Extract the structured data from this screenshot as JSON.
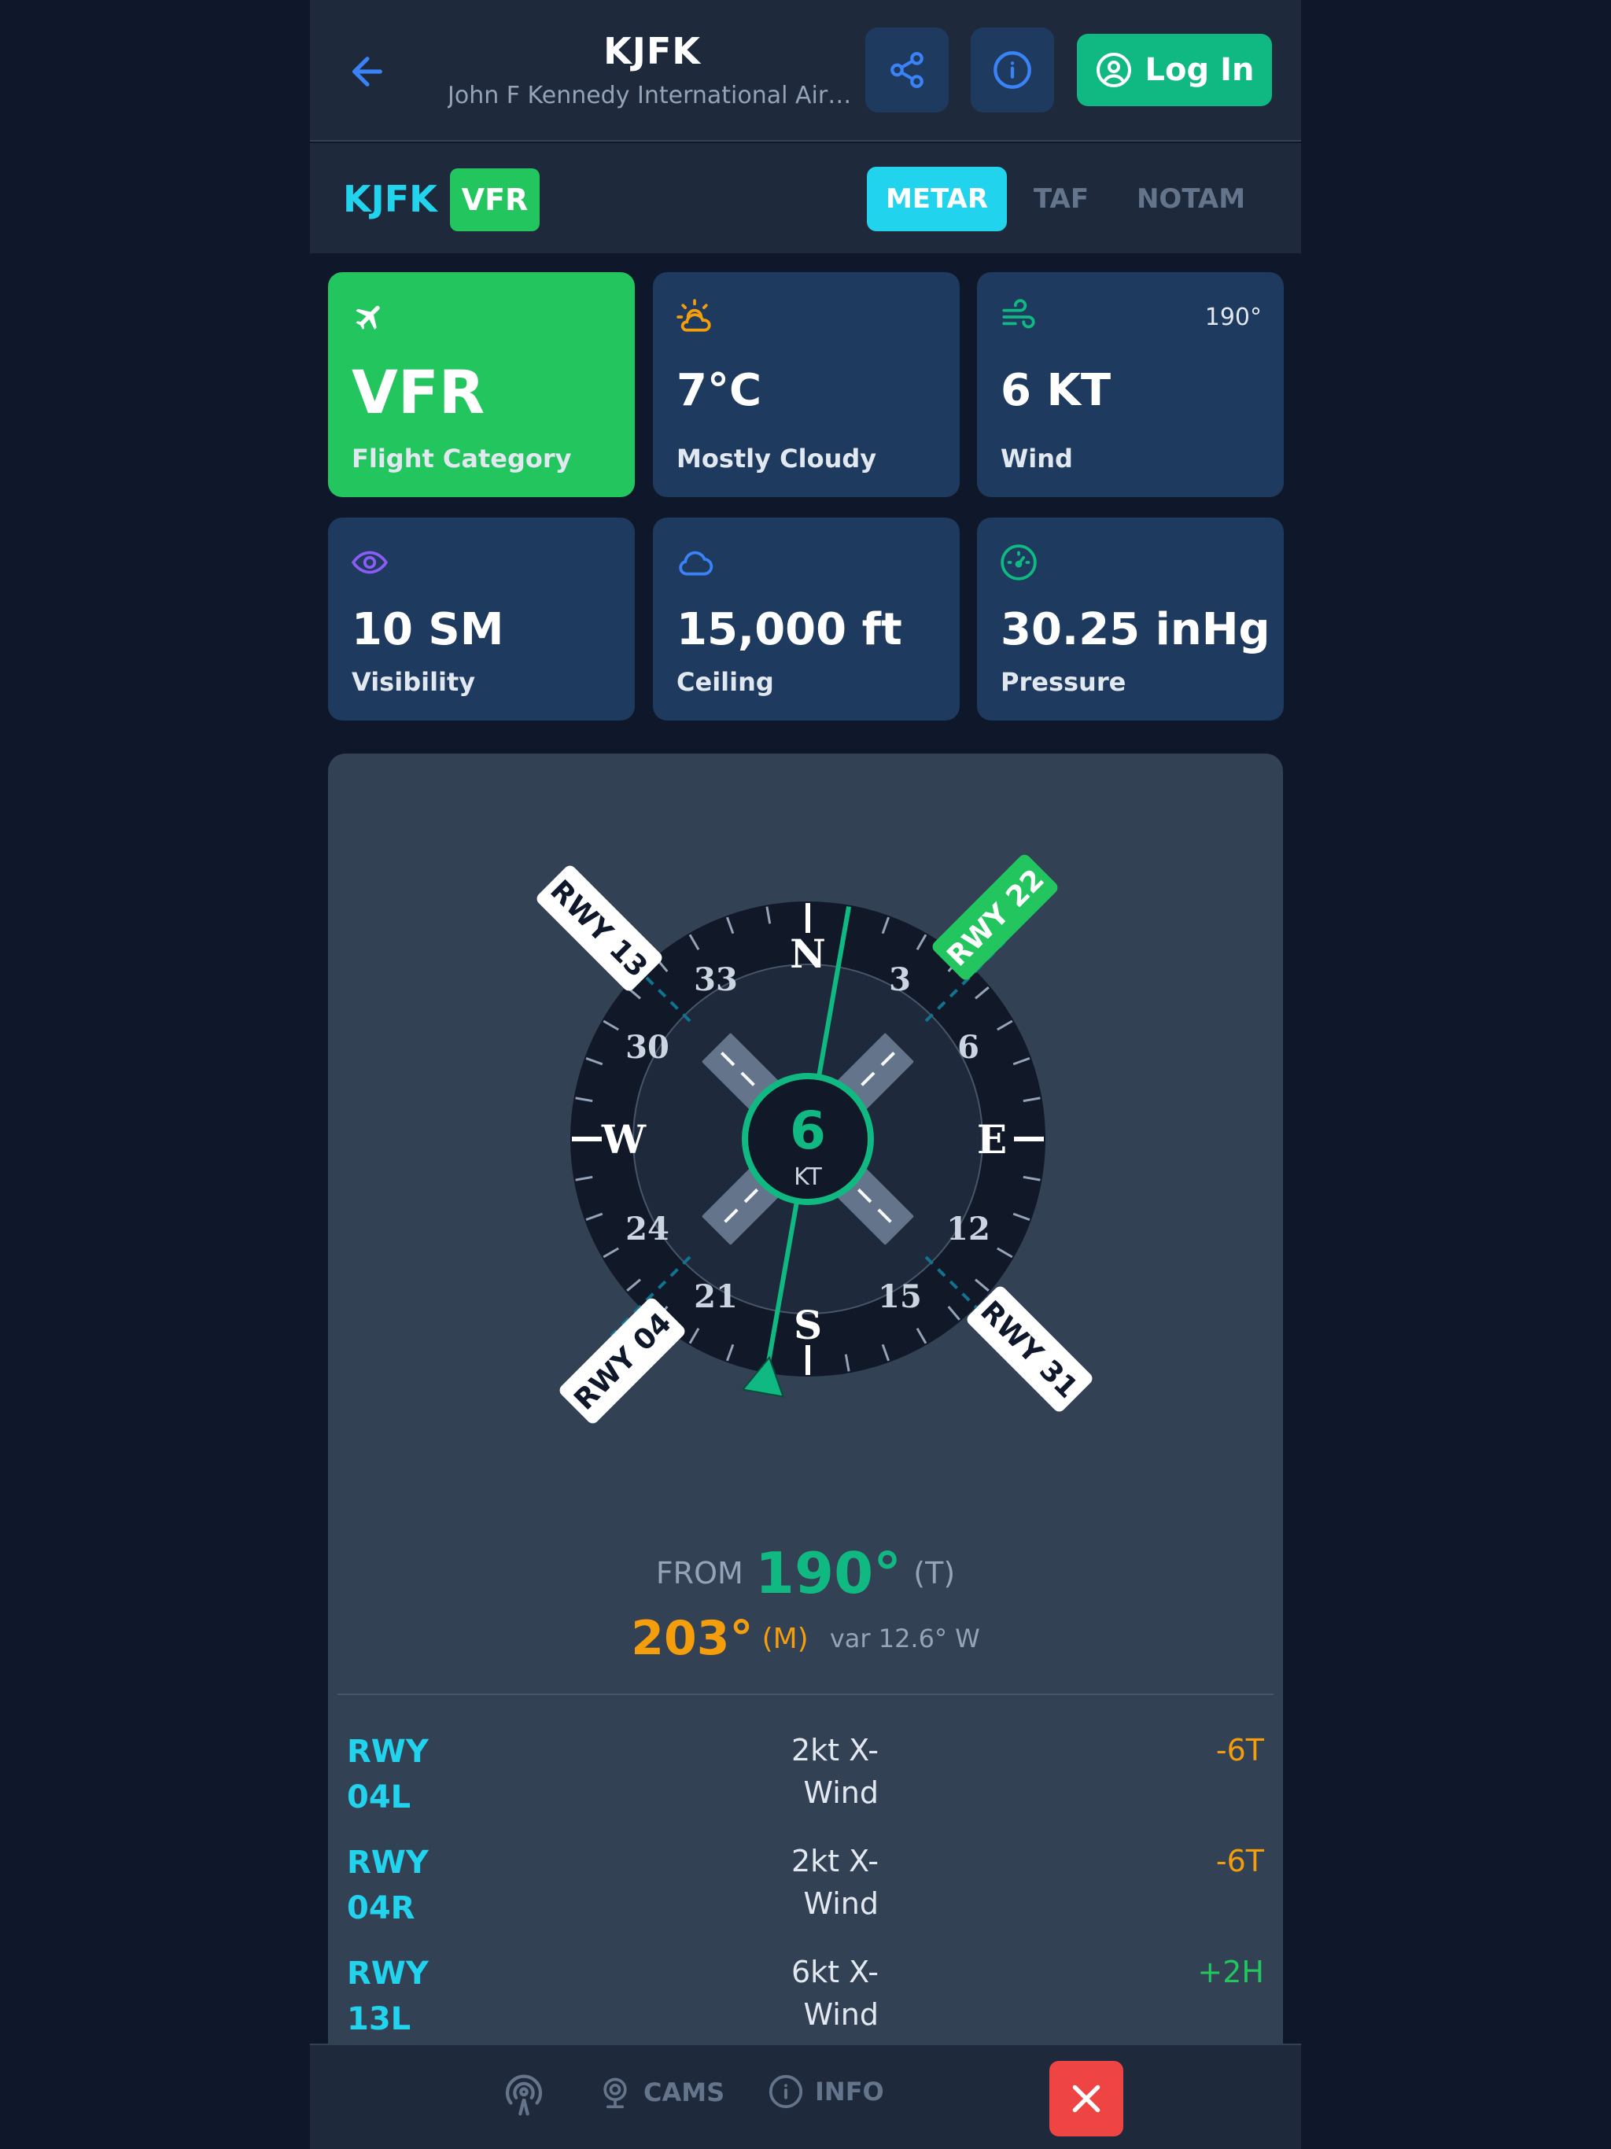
{
  "header": {
    "title": "KJFK",
    "subtitle": "John F Kennedy International Airp...",
    "login_label": "Log In"
  },
  "subheader": {
    "station": "KJFK",
    "category": "VFR",
    "tabs": [
      {
        "label": "METAR",
        "active": true
      },
      {
        "label": "TAF",
        "active": false
      },
      {
        "label": "NOTAM",
        "active": false
      }
    ]
  },
  "cards": {
    "category": {
      "value": "VFR",
      "label": "Flight Category",
      "icon": "airplane-icon"
    },
    "temperature": {
      "value": "7°C",
      "label": "Mostly Cloudy",
      "icon": "partly-cloudy-icon"
    },
    "wind": {
      "value": "6 KT",
      "label": "Wind",
      "direction": "190°",
      "icon": "wind-icon"
    },
    "visibility": {
      "value": "10 SM",
      "label": "Visibility",
      "icon": "eye-icon"
    },
    "ceiling": {
      "value": "15,000 ft",
      "label": "Ceiling",
      "icon": "cloud-icon"
    },
    "pressure": {
      "value": "30.25 inHg",
      "label": "Pressure",
      "icon": "gauge-icon"
    }
  },
  "compass": {
    "cardinals": {
      "n": "N",
      "e": "E",
      "s": "S",
      "w": "W"
    },
    "numbers": [
      "3",
      "6",
      "12",
      "15",
      "21",
      "24",
      "30",
      "33"
    ],
    "speed": "6",
    "unit": "KT",
    "wind_from_deg": 190,
    "runway_labels": {
      "rwy13": "RWY 13",
      "rwy22": "RWY 22",
      "rwy04": "RWY 04",
      "rwy31": "RWY 31"
    },
    "favored_runway": "RWY 22"
  },
  "wind_summary": {
    "from_label": "FROM",
    "true_deg": "190°",
    "true_ref": "(T)",
    "mag_deg": "203°",
    "mag_ref": "(M)",
    "variation": "var 12.6° W"
  },
  "runways": [
    {
      "name": "RWY 04L",
      "crosswind": "2kt X-Wind",
      "component": "-6T",
      "component_type": "tail"
    },
    {
      "name": "RWY 04R",
      "crosswind": "2kt X-Wind",
      "component": "-6T",
      "component_type": "tail"
    },
    {
      "name": "RWY 13L",
      "crosswind": "6kt X-Wind",
      "component": "+2H",
      "component_type": "head"
    }
  ],
  "bottom_nav": {
    "cams_label": "CAMS",
    "info_label": "INFO"
  },
  "colors": {
    "accent_green": "#10b981",
    "vfr_green": "#22c55e",
    "cyan": "#22d3ee",
    "amber": "#f59e0b",
    "danger": "#ef4444"
  }
}
